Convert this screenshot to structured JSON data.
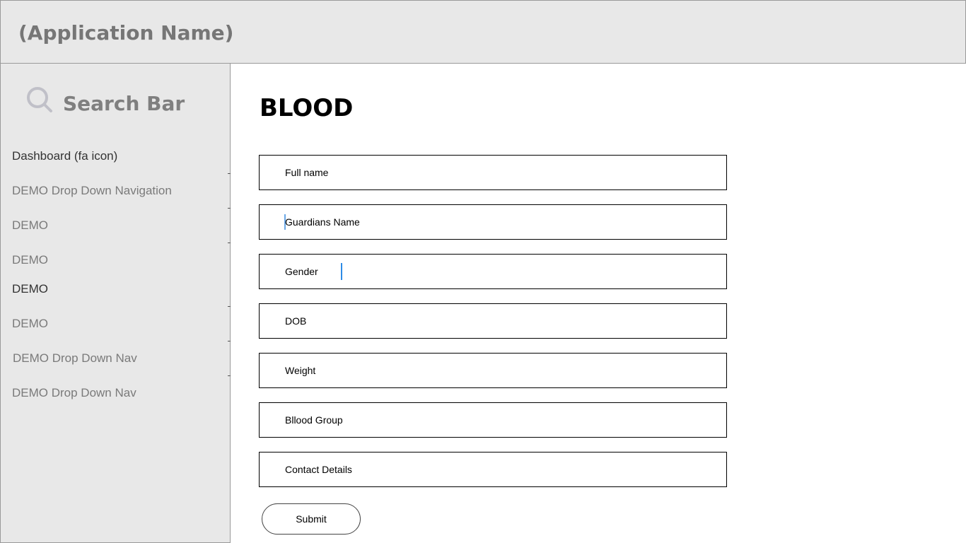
{
  "header": {
    "app_name": "(Application Name)"
  },
  "sidebar": {
    "search": {
      "label": "Search Bar",
      "icon": "search-icon"
    },
    "items": [
      {
        "label": "Dashboard (fa icon)"
      },
      {
        "label": "DEMO Drop Down Navigation"
      },
      {
        "label": "DEMO"
      },
      {
        "label": "DEMO"
      },
      {
        "label": "DEMO"
      },
      {
        "label": "DEMO"
      },
      {
        "label": "DEMO Drop Down Nav"
      },
      {
        "label": "DEMO Drop Down Nav"
      }
    ]
  },
  "main": {
    "title": "BLOOD",
    "fields": [
      {
        "label": "Full name"
      },
      {
        "label": "Guardians Name"
      },
      {
        "label": "Gender"
      },
      {
        "label": "DOB"
      },
      {
        "label": "Weight"
      },
      {
        "label": "Bllood Group"
      },
      {
        "label": "Contact Details"
      }
    ],
    "submit_label": "Submit"
  },
  "colors": {
    "panel_bg": "#e8e8e8",
    "border": "#9a9a9a",
    "caret": "#2e8be6"
  }
}
